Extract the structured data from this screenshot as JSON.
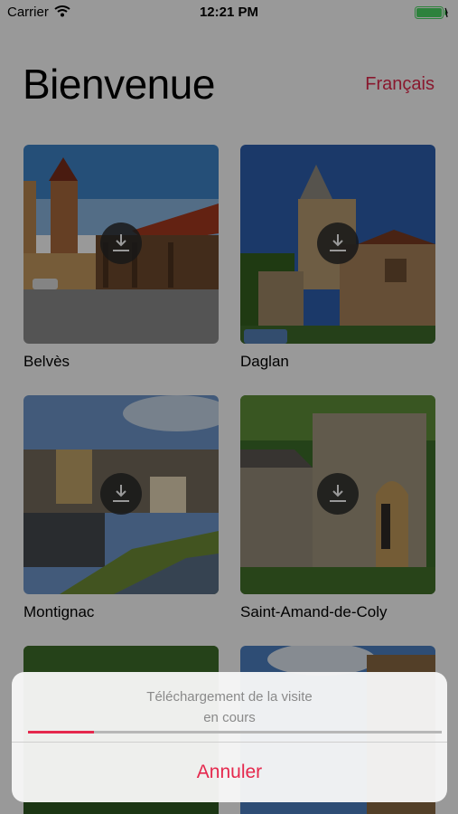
{
  "status_bar": {
    "carrier": "Carrier",
    "time": "12:21 PM",
    "wifi_icon": "wifi-icon",
    "battery_icon": "battery-icon",
    "battery_color": "#4cd964"
  },
  "header": {
    "title": "Bienvenue",
    "language": "Français"
  },
  "tours": [
    {
      "name": "Belvès",
      "download_icon": "download-icon"
    },
    {
      "name": "Daglan",
      "download_icon": "download-icon"
    },
    {
      "name": "Montignac",
      "download_icon": "download-icon"
    },
    {
      "name": "Saint-Amand-de-Coly",
      "download_icon": "download-icon"
    }
  ],
  "download_sheet": {
    "message_line1": "Téléchargement de la visite",
    "message_line2": "en cours",
    "progress": 0.16,
    "cancel_label": "Annuler"
  },
  "colors": {
    "accent": "#e5284d",
    "text": "#000000",
    "secondary_text": "#8a8a8a"
  }
}
